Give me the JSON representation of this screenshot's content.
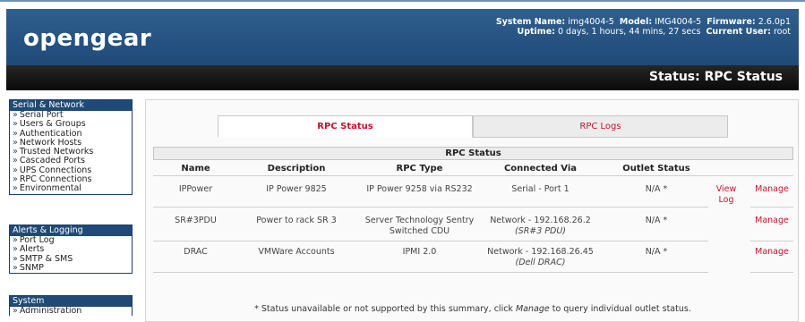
{
  "header": {
    "logo_text": "opengear",
    "system_name_label": "System Name:",
    "system_name_value": "img4004-5",
    "model_label": "Model:",
    "model_value": "IMG4004-5",
    "firmware_label": "Firmware:",
    "firmware_value": "2.6.0p1",
    "uptime_label": "Uptime:",
    "uptime_value": "0 days, 1 hours, 44 mins, 27 secs",
    "current_user_label": "Current User:",
    "current_user_value": "root",
    "page_title": "Status: RPC Status"
  },
  "sidebar": {
    "serial_network": {
      "title": "Serial & Network",
      "items": [
        "Serial Port",
        "Users & Groups",
        "Authentication",
        "Network Hosts",
        "Trusted Networks",
        "Cascaded Ports",
        "UPS Connections",
        "RPC Connections",
        "Environmental"
      ]
    },
    "alerts_logging": {
      "title": "Alerts & Logging",
      "items": [
        "Port Log",
        "Alerts",
        "SMTP & SMS",
        "SNMP"
      ]
    },
    "system": {
      "title": "System",
      "items": [
        "Administration"
      ]
    },
    "arrow": "»"
  },
  "tabs": {
    "rpc_status": "RPC Status",
    "rpc_logs": "RPC Logs"
  },
  "table": {
    "title": "RPC Status",
    "headers": [
      "Name",
      "Description",
      "RPC Type",
      "Connected Via",
      "Outlet Status"
    ],
    "rows": [
      {
        "name": "IPPower",
        "description": "IP Power 9825",
        "rpc_type": "IP Power 9258 via RS232",
        "connected_via": "Serial - Port 1",
        "connected_sub": "",
        "outlet_status": "N/A *",
        "view_log": "View Log",
        "manage": "Manage"
      },
      {
        "name": "SR#3PDU",
        "description": "Power to rack SR 3",
        "rpc_type": "Server Technology Sentry Switched CDU",
        "connected_via": "Network - 192.168.26.2",
        "connected_sub": "(SR#3 PDU)",
        "outlet_status": "N/A *",
        "view_log": "",
        "manage": "Manage"
      },
      {
        "name": "DRAC",
        "description": "VMWare Accounts",
        "rpc_type": "IPMI 2.0",
        "connected_via": "Network - 192.168.26.45",
        "connected_sub": "(Dell DRAC)",
        "outlet_status": "N/A *",
        "view_log": "",
        "manage": "Manage"
      }
    ]
  },
  "footnote": {
    "before": "* Status unavailable or not supported by this summary, click ",
    "link": "Manage",
    "after": " to query individual outlet status."
  },
  "colors": {
    "brand_blue": "#1f4a78",
    "accent_red": "#c8102e"
  }
}
